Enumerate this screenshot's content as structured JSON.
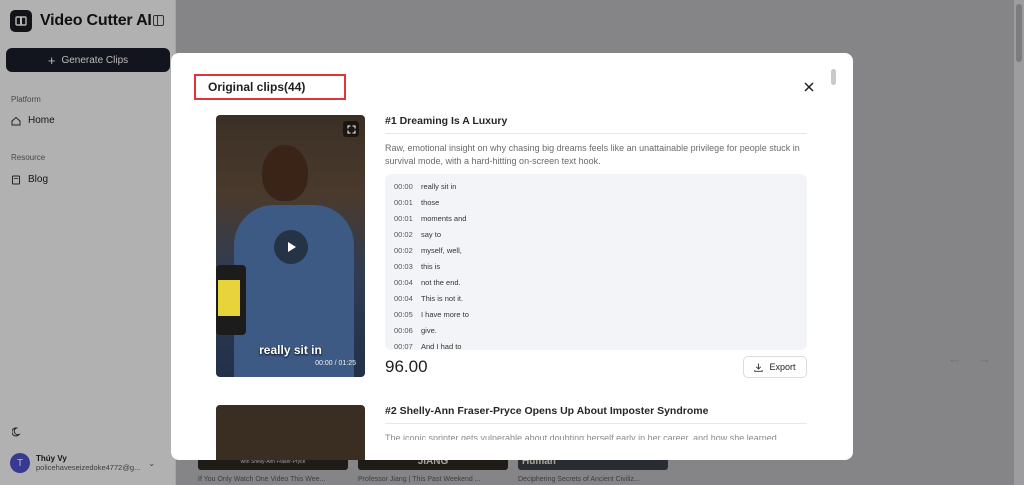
{
  "app": {
    "name": "Video Cutter AI"
  },
  "sidebar": {
    "generate_label": "Generate Clips",
    "platform_label": "Platform",
    "home_label": "Home",
    "resource_label": "Resource",
    "blog_label": "Blog",
    "user": {
      "initial": "T",
      "name": "Thúy Vy",
      "email": "policehaveseizedoke4772@g..."
    }
  },
  "background": {
    "thumbs": [
      {
        "text": "with Shelly-Ann Fraser-Pryce",
        "caption": "If You Only Watch One Video This Wee..."
      },
      {
        "text": "JIANG",
        "caption": "Professor Jiang | This Past Weekend ..."
      },
      {
        "text": "Human",
        "caption": "Deciphering Secrets of Ancient Civiliz..."
      }
    ]
  },
  "modal": {
    "title": "Original clips(44)",
    "clips": [
      {
        "title": "#1 Dreaming Is A Luxury",
        "description": "Raw, emotional insight on why chasing big dreams feels like an unattainable privilege for people stuck in survival mode, with a hard-hitting on-screen text hook.",
        "caption": "really sit in",
        "time": "00:00 / 01:25",
        "score": "96.00",
        "export_label": "Export",
        "transcript": [
          {
            "time": "00:00",
            "text": "really sit in"
          },
          {
            "time": "00:01",
            "text": "those"
          },
          {
            "time": "00:01",
            "text": "moments and"
          },
          {
            "time": "00:02",
            "text": "say to"
          },
          {
            "time": "00:02",
            "text": "myself, well,"
          },
          {
            "time": "00:03",
            "text": "this is"
          },
          {
            "time": "00:04",
            "text": "not the end."
          },
          {
            "time": "00:04",
            "text": "This is not it."
          },
          {
            "time": "00:05",
            "text": "I have more to"
          },
          {
            "time": "00:06",
            "text": "give."
          },
          {
            "time": "00:07",
            "text": "And I had to"
          }
        ]
      },
      {
        "title": "#2 Shelly-Ann Fraser-Pryce Opens Up About Imposter Syndrome",
        "description": "The iconic sprinter gets vulnerable about doubting herself early in her career, and how she learned"
      }
    ]
  },
  "colors": {
    "accent_dark": "#1b1e2a",
    "highlight_box": "#e0333a",
    "avatar": "#4c52c9"
  }
}
